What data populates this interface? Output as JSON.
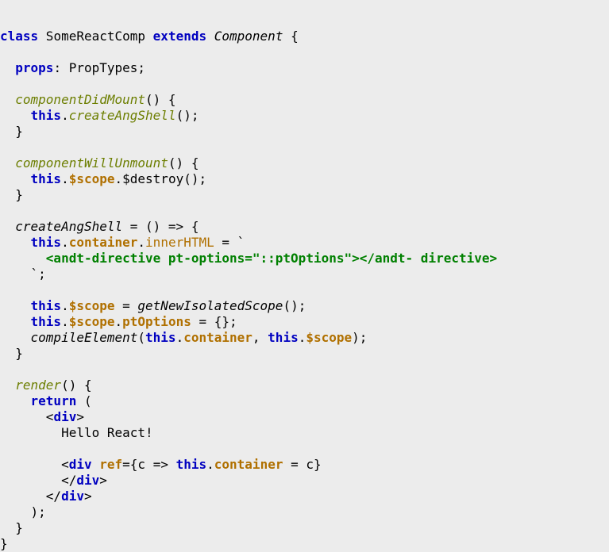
{
  "code": {
    "l1_class": "class",
    "l1_name": " SomeReactComp ",
    "l1_extends": "extends",
    "l1_component": "Component",
    "l1_brace": " {",
    "l3_props": "props",
    "l3_rest": ": PropTypes;",
    "l5_fn": "componentDidMount",
    "l5_rest": "() {",
    "l6_this": "this",
    "l6_dot": ".",
    "l6_call": "createAngShell",
    "l6_end": "();",
    "l7_close": "  }",
    "l9_fn": "componentWillUnmount",
    "l9_rest": "() {",
    "l10_this": "this",
    "l10_dot1": ".",
    "l10_scope": "$scope",
    "l10_dot2": ".",
    "l10_rest": "$destroy();",
    "l11_close": "  }",
    "l13_name": "createAngShell",
    "l13_rest": " = () => {",
    "l14_this": "this",
    "l14_d1": ".",
    "l14_container": "container",
    "l14_d2": ".",
    "l14_inner": "innerHTML",
    "l14_eq": " = `",
    "l15_str": "      <andt-directive pt-options=\"::ptOptions\"></andt- directive>",
    "l16_backtick": "    `",
    "l16_semi": ";",
    "l18_this": "this",
    "l18_d1": ".",
    "l18_scope": "$scope",
    "l18_eq": " = ",
    "l18_call": "getNewIsolatedScope",
    "l18_end": "();",
    "l19_this": "this",
    "l19_d1": ".",
    "l19_scope": "$scope",
    "l19_d2": ".",
    "l19_pt": "ptOptions",
    "l19_rest": " = {};",
    "l20_compile": "compileElement",
    "l20_open": "(",
    "l20_this1": "this",
    "l20_d1": ".",
    "l20_cont": "container",
    "l20_comma": ", ",
    "l20_this2": "this",
    "l20_d2": ".",
    "l20_scope": "$scope",
    "l20_close": ");",
    "l21_close": "  }",
    "l23_fn": "render",
    "l23_rest": "() {",
    "l24_return": "return",
    "l24_rest": " (",
    "l25_lt": "      <",
    "l25_div": "div",
    "l25_gt": ">",
    "l26_txt": "        Hello React!",
    "l28_lt": "        <",
    "l28_div": "div",
    "l28_sp": " ",
    "l28_ref": "ref",
    "l28_eq": "=",
    "l28_brace": "{c => ",
    "l28_this": "this",
    "l28_d": ".",
    "l28_cont": "container",
    "l28_rest": " = c}",
    "l29_lt": "        </",
    "l29_div": "div",
    "l29_gt": ">",
    "l30_lt": "      </",
    "l30_div": "div",
    "l30_gt": ">",
    "l31_close": "    );",
    "l32_close": "  }",
    "l33_close": "}"
  }
}
